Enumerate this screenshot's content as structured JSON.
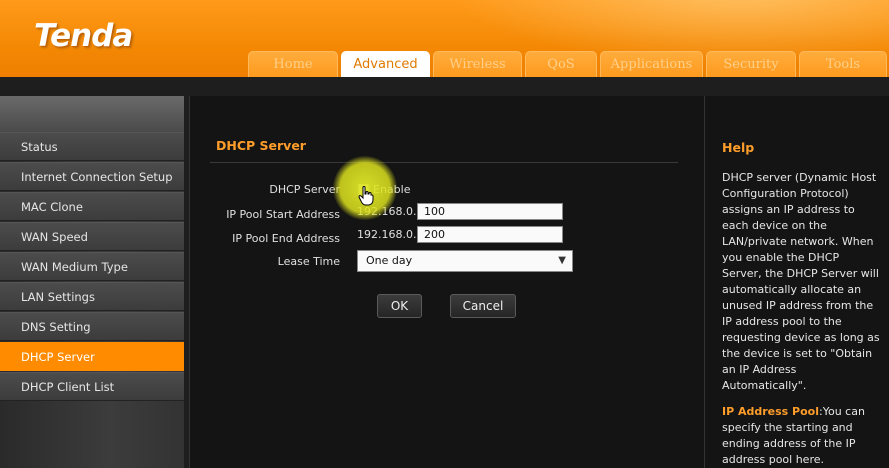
{
  "brand": {
    "logo": "Tenda"
  },
  "nav": {
    "tabs": [
      {
        "label": "Home"
      },
      {
        "label": "Advanced"
      },
      {
        "label": "Wireless"
      },
      {
        "label": "QoS"
      },
      {
        "label": "Applications"
      },
      {
        "label": "Security"
      },
      {
        "label": "Tools"
      }
    ],
    "active": "Advanced"
  },
  "sidebar": {
    "items": [
      {
        "label": "Status"
      },
      {
        "label": "Internet Connection Setup"
      },
      {
        "label": "MAC Clone"
      },
      {
        "label": "WAN Speed"
      },
      {
        "label": "WAN Medium Type"
      },
      {
        "label": "LAN Settings"
      },
      {
        "label": "DNS Setting"
      },
      {
        "label": "DHCP Server"
      },
      {
        "label": "DHCP Client List"
      }
    ],
    "active": "DHCP Server"
  },
  "main": {
    "title": "DHCP Server",
    "form": {
      "dhcp_server_label": "DHCP Server",
      "enable_label": "Enable",
      "start_label": "IP Pool Start Address",
      "start_prefix": "192.168.0.",
      "start_value": "100",
      "end_label": "IP Pool End Address",
      "end_prefix": "192.168.0.",
      "end_value": "200",
      "lease_label": "Lease Time",
      "lease_value": "One day"
    },
    "buttons": {
      "ok": "OK",
      "cancel": "Cancel"
    }
  },
  "help": {
    "title": "Help",
    "body": "DHCP server (Dynamic Host Configuration Protocol) assigns an IP address to each device on the LAN/private network. When you enable the DHCP Server, the DHCP Server will automatically allocate an unused IP address from the IP address pool to the requesting device as long as the device is set to \"Obtain an IP Address Automatically\".",
    "pool_title": "IP Address Pool",
    "pool_body": ":You can specify the starting and ending address of the IP address pool here."
  },
  "colors": {
    "accent": "#ff8c00",
    "header": "#f58a06",
    "help_title": "#ff9d2a"
  },
  "icons": {
    "cursor": "hand-pointer-icon",
    "select": "chevron-down-icon"
  }
}
